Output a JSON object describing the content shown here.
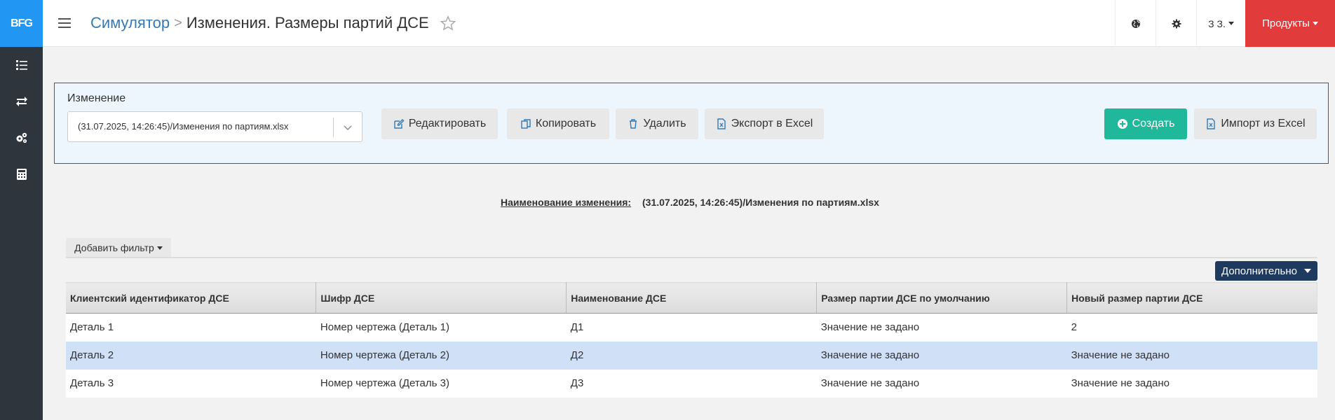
{
  "app": {
    "logo_text": "BFG",
    "accent": "#2196f3",
    "sidebar_bg": "#2e353d"
  },
  "sidebar": {
    "items": [
      {
        "icon": "list-icon"
      },
      {
        "icon": "exchange-icon"
      },
      {
        "icon": "gears-icon"
      },
      {
        "icon": "calculator-icon"
      }
    ]
  },
  "header": {
    "breadcrumb_root": "Симулятор",
    "breadcrumb_sep": ">",
    "title": "Изменения. Размеры партий ДСЕ",
    "user_label": "З З.",
    "products_label": "Продукты",
    "products_color": "#e23b3b"
  },
  "panel": {
    "label": "Изменение",
    "select_value": "(31.07.2025, 14:26:45)/Изменения по партиям.xlsx",
    "buttons": {
      "edit": "Редактировать",
      "copy": "Копировать",
      "delete": "Удалить",
      "export": "Экспорт в Excel",
      "create": "Создать",
      "import": "Импорт из Excel"
    },
    "create_color": "#1fb89a"
  },
  "info": {
    "label": "Наименование изменения:",
    "value": "(31.07.2025, 14:26:45)/Изменения по партиям.xlsx"
  },
  "toolbar": {
    "add_filter": "Добавить фильтр",
    "more": "Дополнительно"
  },
  "table": {
    "columns": [
      "Клиентский идентификатор ДСЕ",
      "Шифр ДСЕ",
      "Наименование ДСЕ",
      "Размер партии ДСЕ по умолчанию",
      "Новый размер партии ДСЕ"
    ],
    "rows": [
      [
        "Деталь 1",
        "Номер чертежа (Деталь 1)",
        "Д1",
        "Значение не задано",
        "2"
      ],
      [
        "Деталь 2",
        "Номер чертежа (Деталь 2)",
        "Д2",
        "Значение не задано",
        "Значение не задано"
      ],
      [
        "Деталь 3",
        "Номер чертежа (Деталь 3)",
        "Д3",
        "Значение не задано",
        "Значение не задано"
      ]
    ],
    "selected_color": "#cfe0f7"
  }
}
